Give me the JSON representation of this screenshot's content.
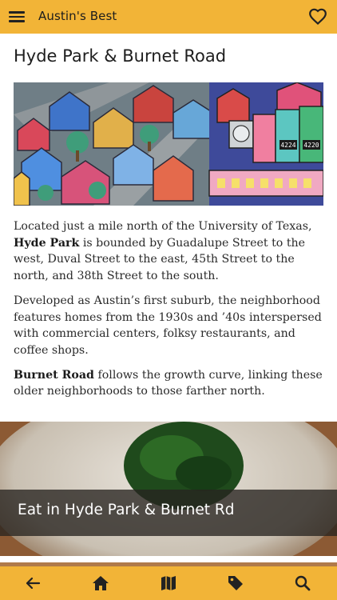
{
  "header": {
    "title": "Austin's Best",
    "menu_icon": "hamburger-menu-icon",
    "favorite_icon": "heart-icon"
  },
  "page": {
    "title": "Hyde Park & Burnet Road"
  },
  "hero_image": {
    "meter_numbers": [
      "4224",
      "4220"
    ]
  },
  "article": {
    "p1_pre": "Located just a mile north of the University of Texas,",
    "p1_bold": "Hyde Park",
    "p1_post": "is bounded by Guadalupe Street to the west, Duval Street to the east, 45th Street to the north, and 38th Street to the south.",
    "p2": "Developed as Austin’s first suburb, the neighborhood features homes from the 1930s and ’40s interspersed with commercial centers, folksy restaurants, and coffee shops.",
    "p3_bold": "Burnet Road",
    "p3_post": "follows the growth curve, linking these older neighborhoods to those farther north."
  },
  "eat_card": {
    "label": "Eat in Hyde Park & Burnet Rd"
  },
  "bottom_nav": {
    "items": [
      "back-arrow-icon",
      "home-icon",
      "map-icon",
      "tag-icon",
      "search-icon"
    ]
  },
  "colors": {
    "accent": "#f2b437",
    "text": "#2a2a2a"
  }
}
